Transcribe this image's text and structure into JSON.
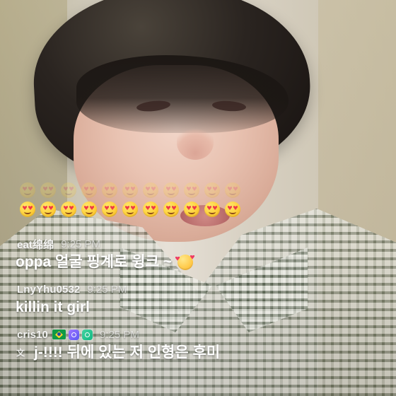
{
  "stream": {
    "emoji_row_count": 11,
    "comments": [
      {
        "username": "eat绵绵",
        "time": "9:25 PM",
        "message": "oppa 얼굴 핑계로 윙크 ~",
        "message_emoji": "smiling-face-with-hearts"
      },
      {
        "username": "LnyYhu0532",
        "time": "9:25 PM",
        "message": "killin it girl"
      },
      {
        "username": "cris10",
        "time": "9:25 PM",
        "badges": [
          "brazil-flag",
          "purple-badge",
          "green-badge"
        ],
        "message": "j-!!!! 뒤에 있는 저 인형은 후미",
        "translate_icon": "translate-icon"
      }
    ]
  },
  "colors": {
    "text_primary": "#ffffff",
    "text_secondary": "rgba(255,255,255,0.62)",
    "emoji_yellow": "#ffd33f",
    "heart_red": "#ef3b48",
    "brazil_green": "#0f9a46",
    "brazil_yellow": "#ffd329",
    "brazil_blue": "#1f4aa8",
    "badge_purple": "#7d68f7",
    "badge_green": "#10b981"
  }
}
